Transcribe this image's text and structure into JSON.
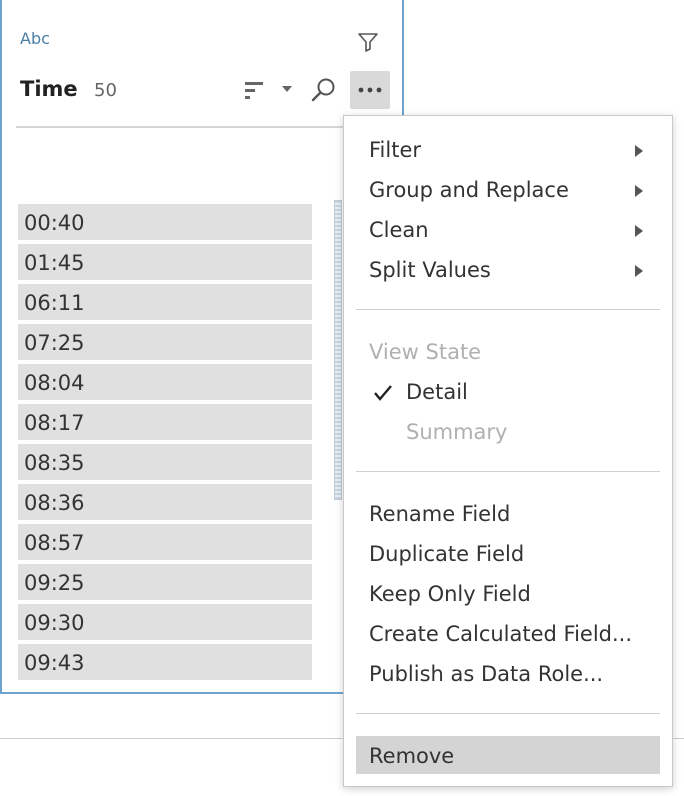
{
  "card": {
    "type_label": "Abc",
    "field_name": "Time",
    "count": "50",
    "values": [
      "00:40",
      "01:45",
      "06:11",
      "07:25",
      "08:04",
      "08:17",
      "08:35",
      "08:36",
      "08:57",
      "09:25",
      "09:30",
      "09:43"
    ]
  },
  "menu": {
    "filter": "Filter",
    "group_and_replace": "Group and Replace",
    "clean": "Clean",
    "split_values": "Split Values",
    "view_state": "View State",
    "detail": "Detail",
    "summary": "Summary",
    "rename_field": "Rename Field",
    "duplicate_field": "Duplicate Field",
    "keep_only_field": "Keep Only Field",
    "create_calculated_field": "Create Calculated Field...",
    "publish_as_data_role": "Publish as Data Role...",
    "remove": "Remove"
  },
  "colors": {
    "accent_border": "#6fa3cf",
    "type_label": "#4a7fa8",
    "value_bg": "#e0e0e0",
    "highlight": "#d4d4d4"
  },
  "icons": {
    "filter": "filter-funnel-icon",
    "sort": "sort-bars-icon",
    "search": "search-icon",
    "more": "more-ellipsis-icon",
    "check": "check-icon",
    "submenu": "chevron-right-icon"
  }
}
